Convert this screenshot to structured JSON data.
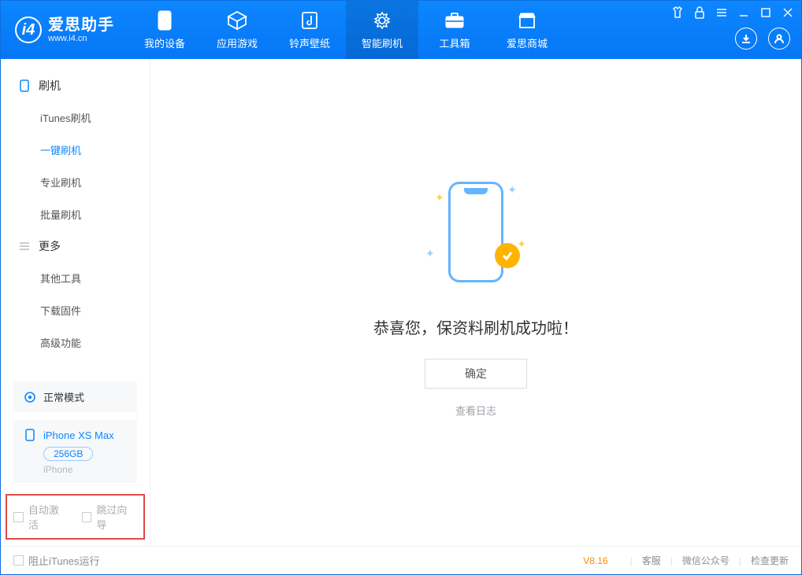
{
  "app": {
    "name_cn": "爱思助手",
    "url": "www.i4.cn"
  },
  "nav": {
    "my_device": "我的设备",
    "apps_games": "应用游戏",
    "ringtone_wallpaper": "铃声壁纸",
    "smart_flash": "智能刷机",
    "toolbox": "工具箱",
    "aisi_store": "爱思商城"
  },
  "sidebar": {
    "group_flash": "刷机",
    "items_flash": {
      "itunes": "iTunes刷机",
      "one_key": "一键刷机",
      "pro": "专业刷机",
      "batch": "批量刷机"
    },
    "group_more": "更多",
    "items_more": {
      "other_tools": "其他工具",
      "download_fw": "下载固件",
      "advanced": "高级功能"
    }
  },
  "status": {
    "mode": "正常模式"
  },
  "device": {
    "name": "iPhone XS Max",
    "capacity": "256GB",
    "platform": "iPhone"
  },
  "options": {
    "auto_activate": "自动激活",
    "skip_guide": "跳过向导"
  },
  "main": {
    "success_title": "恭喜您，保资料刷机成功啦！",
    "ok": "确定",
    "view_log": "查看日志"
  },
  "footer": {
    "block_itunes": "阻止iTunes运行",
    "version": "V8.16",
    "customer_service": "客服",
    "wechat": "微信公众号",
    "check_update": "检查更新"
  }
}
